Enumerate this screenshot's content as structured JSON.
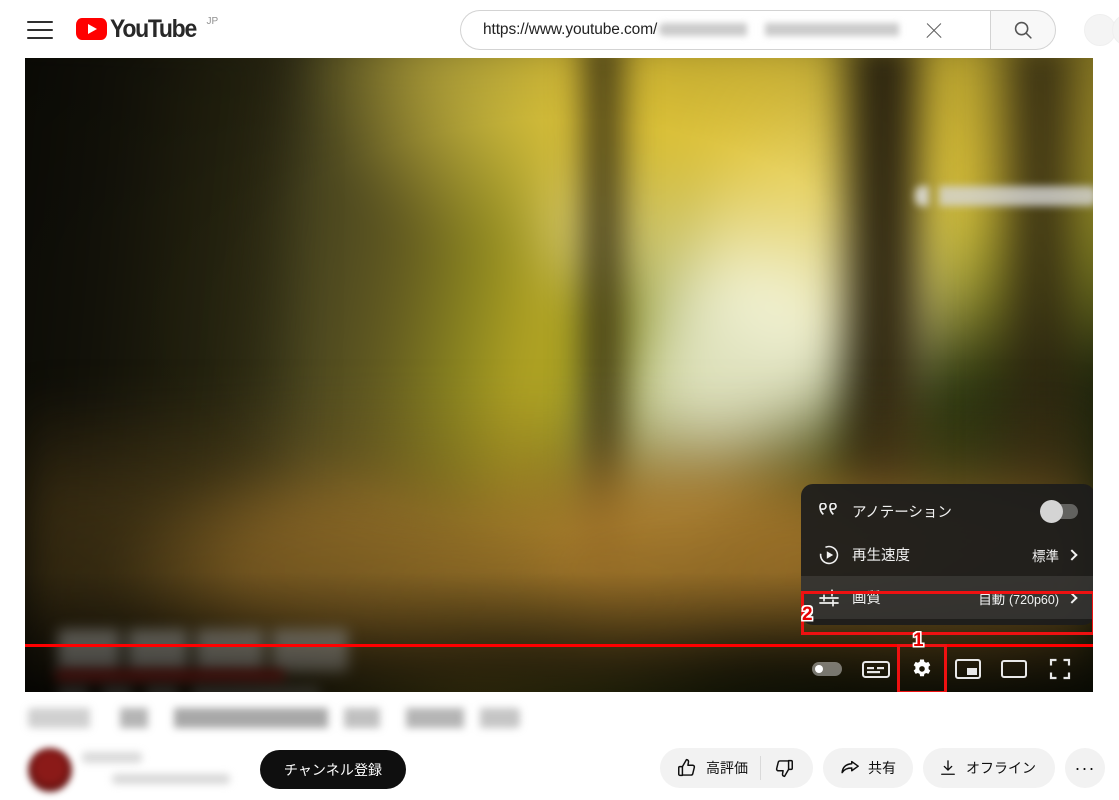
{
  "browser": {
    "menu_icon": "hamburger-icon",
    "logo_text": "YouTube",
    "logo_country": "JP",
    "search": {
      "value_prefix": "https://www.youtube.com/",
      "placeholder": "検索",
      "clear_icon": "close-icon",
      "search_icon": "search-icon"
    }
  },
  "player": {
    "progress_percent": 100,
    "controls": {
      "autoplay": "autoplay-toggle",
      "subtitles": "subtitles-icon",
      "settings": "gear-icon",
      "miniplayer": "miniplayer-icon",
      "theater": "theater-icon",
      "fullscreen": "fullscreen-icon"
    },
    "settings_menu": {
      "items": [
        {
          "icon": "annotations-icon",
          "label": "アノテーション",
          "control": "toggle",
          "toggle_on": false,
          "highlighted": false
        },
        {
          "icon": "playback-speed-icon",
          "label": "再生速度",
          "control": "value",
          "value": "標準",
          "highlighted": false
        },
        {
          "icon": "quality-icon",
          "label": "画質",
          "control": "value",
          "value": "自動",
          "value_detail": "(720p60)",
          "highlighted": true
        }
      ]
    }
  },
  "annotations": {
    "marker_one": "1",
    "marker_two": "2",
    "highlight_color": "#ee1111"
  },
  "video_meta": {
    "subscribe_label": "チャンネル登録",
    "actions": [
      {
        "name": "like-button",
        "label": "高評価",
        "icon": "thumbs-up-icon"
      },
      {
        "name": "dislike-button",
        "label": "",
        "icon": "thumbs-down-icon"
      },
      {
        "name": "share-button",
        "label": "共有",
        "icon": "share-icon"
      },
      {
        "name": "offline-button",
        "label": "オフライン",
        "icon": "download-icon"
      },
      {
        "name": "more-button",
        "label": "···",
        "icon": "more-horizontal-icon"
      }
    ]
  }
}
